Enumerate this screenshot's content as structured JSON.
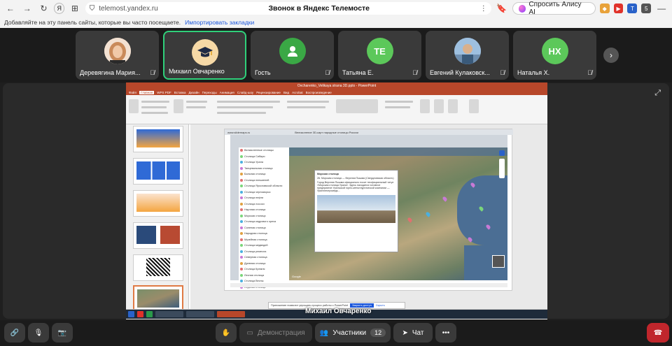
{
  "browser": {
    "url": "telemost.yandex.ru",
    "page_title": "Звонок в Яндекс Телемосте",
    "alice_button": "Спросить Алису AI",
    "bookmarks_hint": "Добавляйте на эту панель сайты, которые вы часто посещаете.",
    "bookmarks_link": "Импортировать закладки",
    "ext_badge": "5"
  },
  "participants": [
    {
      "name": "Деревягина Мария...",
      "initials": "",
      "color": "#f0d6c0",
      "type": "photo-woman",
      "muted": true,
      "active": false
    },
    {
      "name": "Михаил Овчаренко",
      "initials": "",
      "color": "#f6d9a6",
      "type": "graduation-cap",
      "muted": false,
      "active": true
    },
    {
      "name": "Гость",
      "initials": "",
      "color": "#3aa845",
      "type": "person",
      "muted": true,
      "active": false
    },
    {
      "name": "Татьяна Е.",
      "initials": "TE",
      "color": "#5cc85a",
      "type": "initials",
      "muted": true,
      "active": false
    },
    {
      "name": "Евгений Кулаковск...",
      "initials": "",
      "color": "#8fa9c4",
      "type": "photo-man",
      "muted": true,
      "active": false
    },
    {
      "name": "Наталья Х.",
      "initials": "HX",
      "color": "#5cc85a",
      "type": "initials",
      "muted": true,
      "active": false
    }
  ],
  "shared_screen": {
    "window_title": "Ovcharenko_Velikaya strana 3D.pptx - PowerPoint",
    "tabs": [
      "Файл",
      "Главная",
      "WPS PDF",
      "Вставка",
      "Дизайн",
      "Переходы",
      "Анимация",
      "Слайд-шоу",
      "Рецензирование",
      "Вид",
      "Acrobat",
      "Воспроизведение"
    ],
    "active_tab": "Главная",
    "inner_url": "www.slidemaps.ru",
    "inner_title": "Великолепие 3D-карт народные столицы России",
    "list_items": [
      "Великолепные столицы",
      "Столица Сибири",
      "Столица Урала",
      "Танцевальная столица",
      "Бальная столица",
      "Столица пельменей",
      "Столица Ярославской области",
      "Столица черноморья",
      "Столица нефти",
      "Столица лососи",
      "Научная столица",
      "Морская столица",
      "Столица кедрового ореха",
      "Соленая столица",
      "Народная столица",
      "Музейная столица",
      "Столица медведей",
      "Столица ремесла",
      "Северная столица",
      "Древняя столица",
      "Столица Кремля",
      "Лесная столица",
      "Столица Весны",
      "Ледяная столица"
    ],
    "popup_title": "Морская столица",
    "popup_subtitle": "26. Морская столица — Верхняя Пышма (Свердловская область)",
    "popup_text": "Город Верхняя Пышма официально носит неофициальный титул «Морская столица Урала». Здесь находится головное предприятие Уральской горно-металлургической компании — Уралэлектромедь...",
    "notes_placeholder": "Заметки к слайду",
    "notice_text": "Приложение позволит упрощать процесс работы с PowerPoint",
    "notice_btn1": "Закрыть доступ",
    "notice_btn2": "Скрыть",
    "slide_status": "Слайд 5 из 6"
  },
  "speaker_label": "Михаил Овчаренко",
  "controls": {
    "demo_label": "Демонстрация",
    "participants_label": "Участники",
    "participants_count": "12",
    "chat_label": "Чат"
  }
}
